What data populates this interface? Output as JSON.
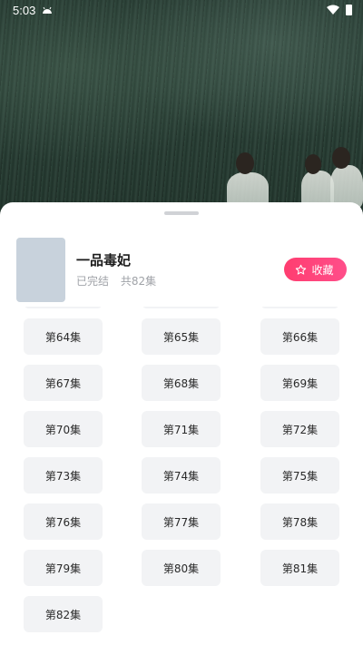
{
  "status_bar": {
    "time": "5:03",
    "icons": [
      "android-debug-icon",
      "wifi-icon",
      "battery-icon"
    ]
  },
  "drama": {
    "title": "一品毒妃",
    "status": "已完结",
    "episode_count": "共82集",
    "favorite_label": "收藏",
    "favorite_icon": "star-outline-icon"
  },
  "colors": {
    "accent": "#ff3d70",
    "episode_bg": "#f2f3f5",
    "sheet_bg": "#ffffff"
  },
  "episodes": [
    [
      "",
      "",
      ""
    ],
    [
      "第64集",
      "第65集",
      "第66集"
    ],
    [
      "第67集",
      "第68集",
      "第69集"
    ],
    [
      "第70集",
      "第71集",
      "第72集"
    ],
    [
      "第73集",
      "第74集",
      "第75集"
    ],
    [
      "第76集",
      "第77集",
      "第78集"
    ],
    [
      "第79集",
      "第80集",
      "第81集"
    ],
    [
      "第82集"
    ]
  ]
}
